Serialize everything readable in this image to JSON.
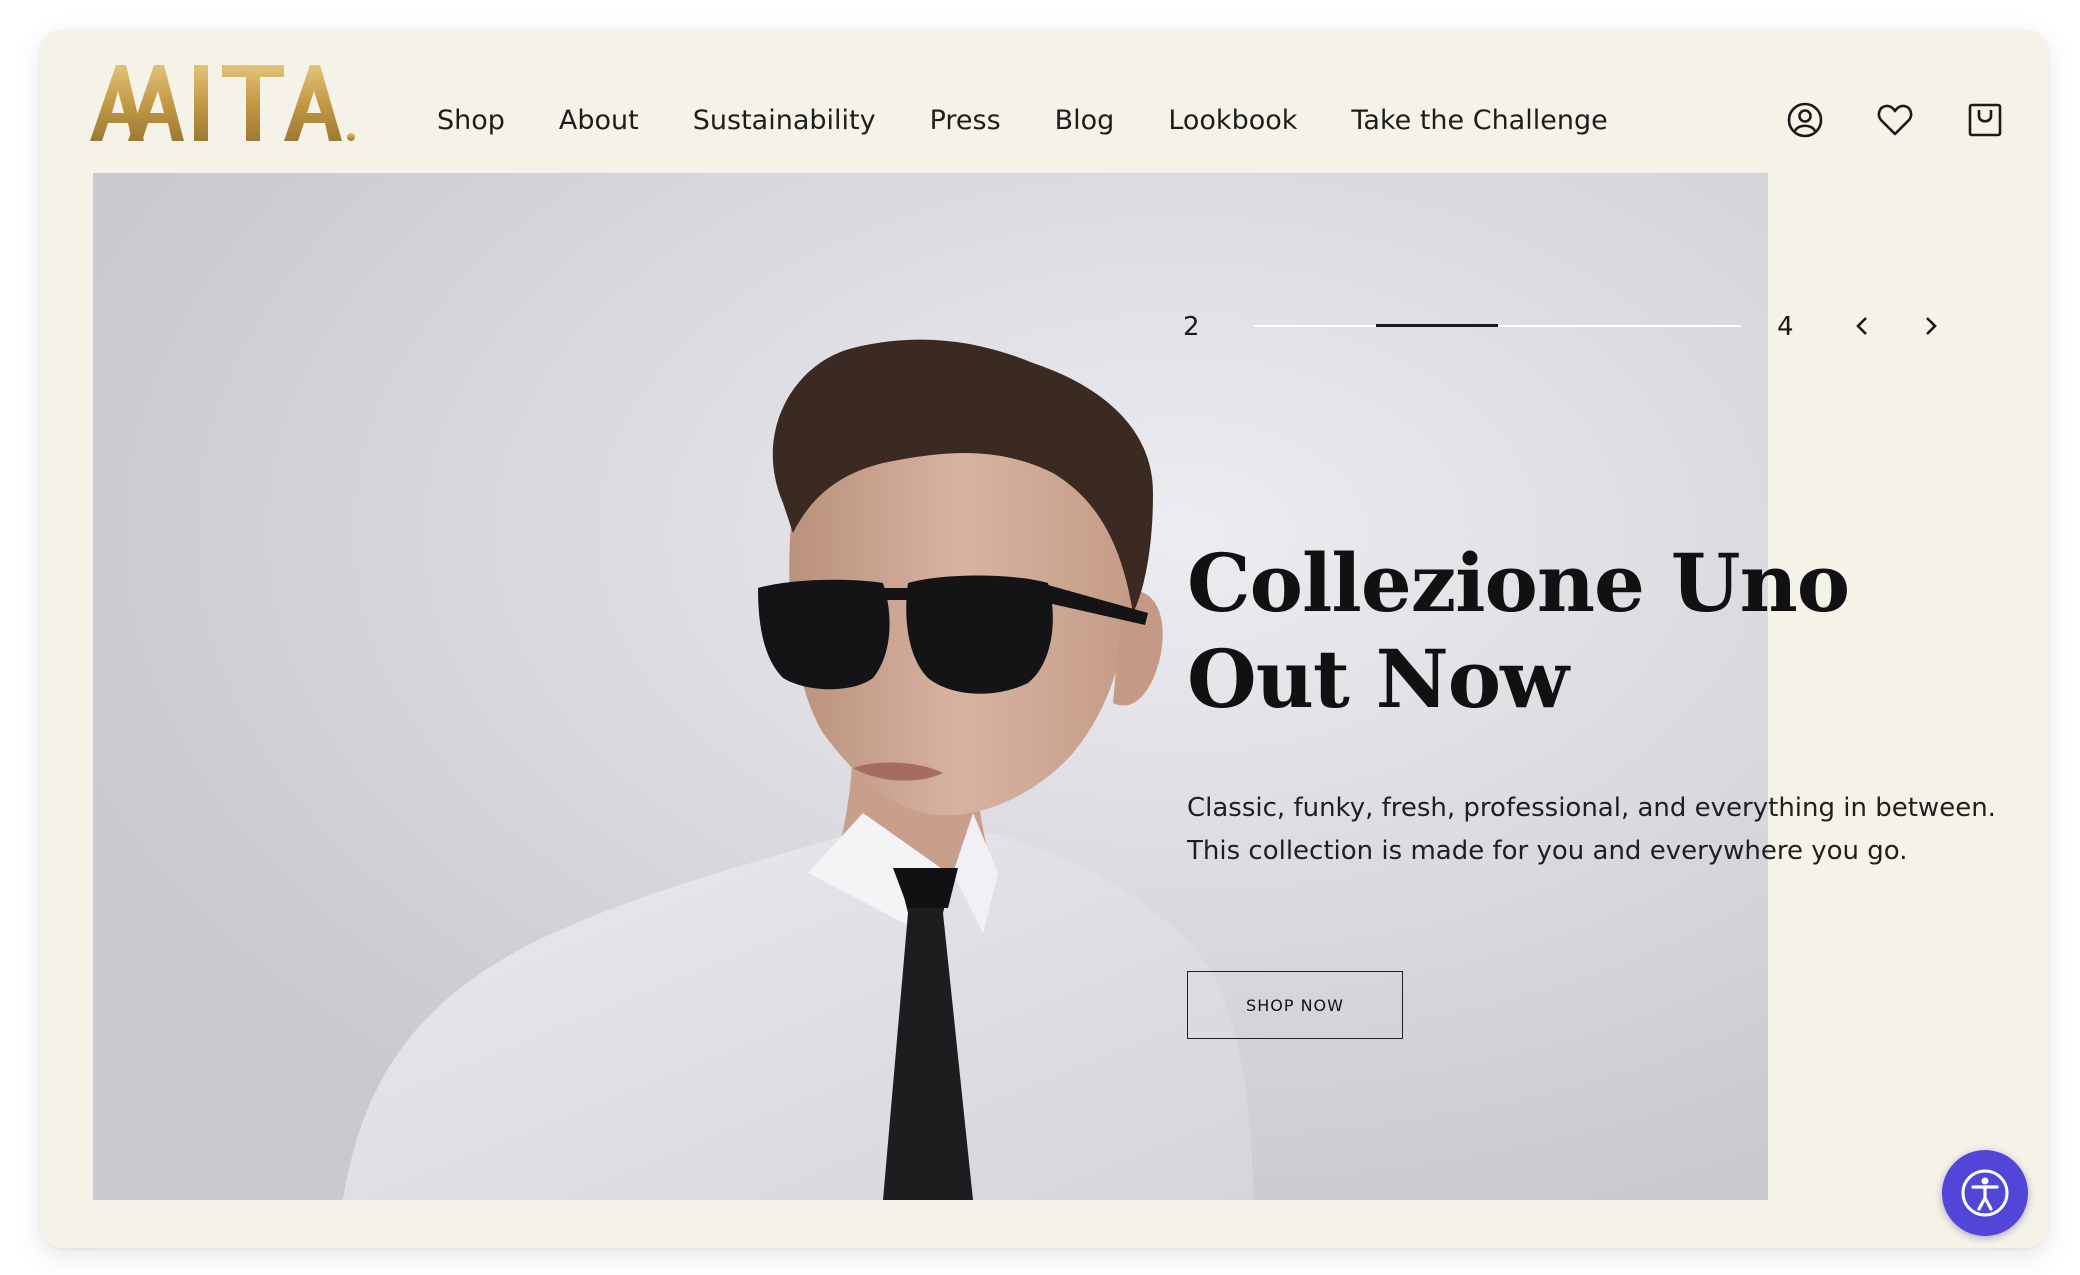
{
  "brand": {
    "logo_text": "AAITA",
    "logo_color": "#c9a24a"
  },
  "nav": {
    "items": [
      {
        "label": "Shop"
      },
      {
        "label": "About"
      },
      {
        "label": "Sustainability"
      },
      {
        "label": "Press"
      },
      {
        "label": "Blog"
      },
      {
        "label": "Lookbook"
      },
      {
        "label": "Take the Challenge"
      }
    ]
  },
  "header_icons": [
    "account-icon",
    "heart-icon",
    "cart-icon"
  ],
  "slider": {
    "current": "2",
    "total": "4",
    "progress": 0.25,
    "prev_icon": "chevron-left-icon",
    "next_icon": "chevron-right-icon"
  },
  "hero": {
    "headline": "Collezione Uno Out Now",
    "description": "Classic, funky, fresh, professional, and everything in between. This collection is made for you and everywhere you go.",
    "cta_label": "SHOP NOW"
  },
  "accessibility_button": {
    "icon": "accessibility-icon",
    "color": "#5146d8"
  },
  "colors": {
    "background": "#f5f2e8",
    "text": "#111111",
    "accent": "#c9a24a"
  }
}
